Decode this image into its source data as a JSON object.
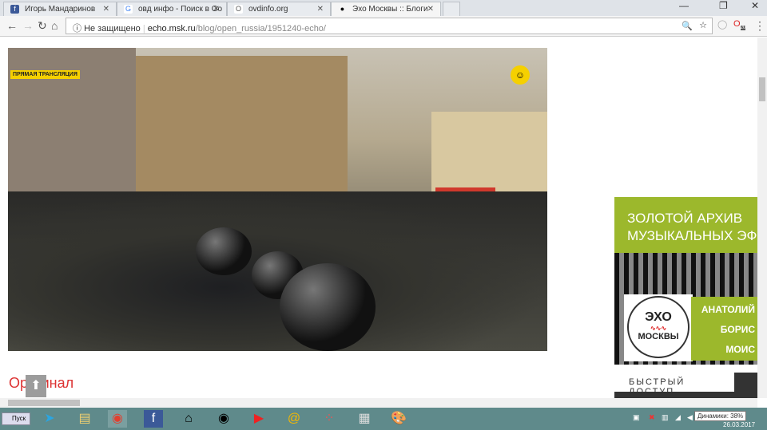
{
  "tabs": [
    {
      "title": "Игорь Мандаринов",
      "icon": "facebook-icon"
    },
    {
      "title": "овд инфо - Поиск в Go",
      "icon": "google-icon"
    },
    {
      "title": "ovdinfo.org",
      "icon": "page-icon"
    },
    {
      "title": "Эхо Москвы :: Блоги",
      "icon": "echo-icon",
      "active": true
    }
  ],
  "toolbar": {
    "security": "Не защищено",
    "url_host": "echo.msk.ru",
    "url_path": "/blog/open_russia/1951240-echo/",
    "ext_badge": "20"
  },
  "video": {
    "live_label": "ПРЯМАЯ ТРАНСЛЯЦИЯ"
  },
  "article": {
    "heading": "Оригинал"
  },
  "ad": {
    "line1": "ЗОЛОТОЙ АРХИВ",
    "line2": "МУЗЫКАЛЬНЫХ ЭФИ",
    "logo_top": "ЭХО",
    "logo_bottom": "МОСКВЫ",
    "names": [
      "АНАТОЛИЙ",
      "БОРИС",
      "МОИС"
    ]
  },
  "quick_access": "БЫСТРЫЙ ДОСТУП",
  "taskbar": {
    "start": "Пуск",
    "tooltip": "Динамики: 38%",
    "date": "26.03.2017"
  }
}
